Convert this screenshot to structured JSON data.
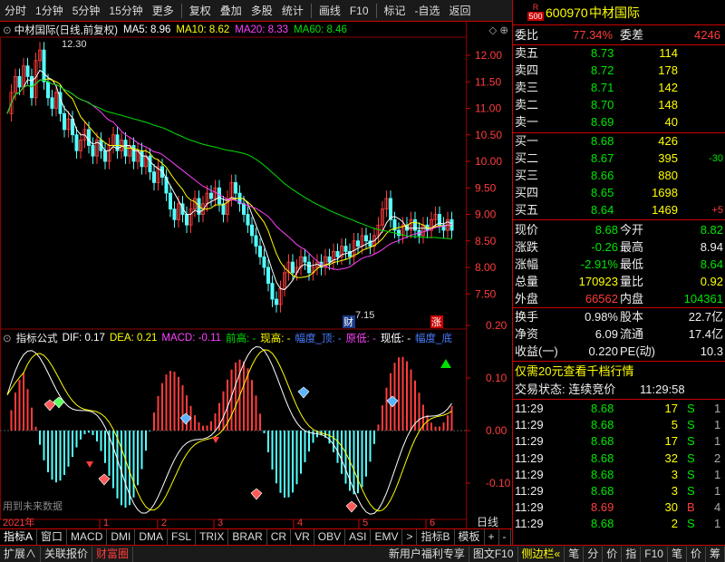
{
  "toolbar": {
    "buttons": [
      "分时",
      "1分钟",
      "5分钟",
      "15分钟",
      "更多",
      "复权",
      "叠加",
      "多股",
      "统计",
      "画线",
      "F10",
      "标记",
      "-自选",
      "返回"
    ]
  },
  "chart": {
    "title": "中材国际(日线,前复权)",
    "ma": [
      {
        "label": "MA5: 8.96",
        "color": "#ffffff"
      },
      {
        "label": "MA10: 8.62",
        "color": "#ffff00"
      },
      {
        "label": "MA20: 8.33",
        "color": "#ff40ff"
      },
      {
        "label": "MA60: 8.46",
        "color": "#00e000"
      }
    ],
    "price_ticks": [
      "12.00",
      "11.50",
      "11.00",
      "10.50",
      "10.00",
      "9.50",
      "9.00",
      "8.50",
      "8.00",
      "7.50"
    ],
    "high_label": "12.30",
    "low_label": "7.15",
    "marker_cai": "财",
    "marker_zhang": "涨"
  },
  "indicator": {
    "title": "指标公式",
    "items": [
      {
        "label": "DIF: 0.17",
        "color": "#ffffff"
      },
      {
        "label": "DEA: 0.21",
        "color": "#ffff00"
      },
      {
        "label": "MACD: -0.11",
        "color": "#ff40ff"
      },
      {
        "label": "前高: -",
        "color": "#00e000"
      },
      {
        "label": "现高: -",
        "color": "#ffff00"
      },
      {
        "label": "幅度_顶: -",
        "color": "#4a7dff"
      },
      {
        "label": "原低: -",
        "color": "#ff40ff"
      },
      {
        "label": "现低: -",
        "color": "#ffffff"
      },
      {
        "label": "幅度_底",
        "color": "#4a7dff"
      }
    ],
    "ticks": [
      "0.20",
      "0.10",
      "0.00",
      "-0.10"
    ],
    "future_note": "用到未来数据"
  },
  "date_axis": {
    "year": "2021年",
    "months": [
      "1",
      "2",
      "3",
      "4",
      "5",
      "6"
    ],
    "unit": "日线"
  },
  "bottom_tabs": [
    "指标A",
    "窗口",
    "MACD",
    "DMI",
    "DMA",
    "FSL",
    "TRIX",
    "BRAR",
    "CR",
    "VR",
    "OBV",
    "ASI",
    "EMV",
    ">",
    "指标B",
    "模板",
    "+",
    "-"
  ],
  "status_bar": [
    "扩展∧",
    "关联报价",
    "财富圈",
    "新用户福利专享",
    "图文F10",
    "侧边栏«",
    "笔",
    "分",
    "价",
    "指",
    "F10",
    "笔",
    "价",
    "筹"
  ],
  "quote": {
    "code": "600970",
    "name": "中材国际",
    "badge_top": "R",
    "badge_bottom": "500",
    "weibi_label": "委比",
    "weibi": "77.34%",
    "weicha_label": "委差",
    "weicha": "4246",
    "asks": [
      {
        "label": "卖五",
        "price": "8.73",
        "vol": "114"
      },
      {
        "label": "卖四",
        "price": "8.72",
        "vol": "178"
      },
      {
        "label": "卖三",
        "price": "8.71",
        "vol": "142"
      },
      {
        "label": "卖二",
        "price": "8.70",
        "vol": "148"
      },
      {
        "label": "卖一",
        "price": "8.69",
        "vol": "40"
      }
    ],
    "bids": [
      {
        "label": "买一",
        "price": "8.68",
        "vol": "426",
        "chg": ""
      },
      {
        "label": "买二",
        "price": "8.67",
        "vol": "395",
        "chg": "-30"
      },
      {
        "label": "买三",
        "price": "8.66",
        "vol": "880",
        "chg": ""
      },
      {
        "label": "买四",
        "price": "8.65",
        "vol": "1698",
        "chg": ""
      },
      {
        "label": "买五",
        "price": "8.64",
        "vol": "1469",
        "chg": "+5"
      }
    ],
    "stats": [
      {
        "l1": "现价",
        "v1": "8.68",
        "c1": "green",
        "l2": "今开",
        "v2": "8.82",
        "c2": "green"
      },
      {
        "l1": "涨跌",
        "v1": "-0.26",
        "c1": "green",
        "l2": "最高",
        "v2": "8.94",
        "c2": "white"
      },
      {
        "l1": "涨幅",
        "v1": "-2.91%",
        "c1": "green",
        "l2": "最低",
        "v2": "8.64",
        "c2": "green"
      },
      {
        "l1": "总量",
        "v1": "170923",
        "c1": "yellow",
        "l2": "量比",
        "v2": "0.92",
        "c2": "yellow"
      },
      {
        "l1": "外盘",
        "v1": "66562",
        "c1": "red",
        "l2": "内盘",
        "v2": "104361",
        "c2": "green"
      }
    ],
    "stats2": [
      {
        "l1": "换手",
        "v1": "0.98%",
        "l2": "股本",
        "v2": "22.7亿"
      },
      {
        "l1": "净资",
        "v1": "6.09",
        "l2": "流通",
        "v2": "17.4亿"
      },
      {
        "l1": "收益(一)",
        "v1": "0.220",
        "l2": "PE(动)",
        "v2": "10.3"
      }
    ],
    "promo": "仅需20元查看千档行情",
    "trade_state": "交易状态: 连续竞价",
    "trade_time": "11:29:58",
    "ticks": [
      {
        "t": "11:29",
        "p": "8.68",
        "v": "17",
        "s": "S",
        "n": "1"
      },
      {
        "t": "11:29",
        "p": "8.68",
        "v": "5",
        "s": "S",
        "n": "1"
      },
      {
        "t": "11:29",
        "p": "8.68",
        "v": "17",
        "s": "S",
        "n": "1"
      },
      {
        "t": "11:29",
        "p": "8.68",
        "v": "32",
        "s": "S",
        "n": "2"
      },
      {
        "t": "11:29",
        "p": "8.68",
        "v": "3",
        "s": "S",
        "n": "1"
      },
      {
        "t": "11:29",
        "p": "8.68",
        "v": "3",
        "s": "S",
        "n": "1"
      },
      {
        "t": "11:29",
        "p": "8.69",
        "v": "30",
        "s": "B",
        "n": "4"
      },
      {
        "t": "11:29",
        "p": "8.68",
        "v": "2",
        "s": "S",
        "n": "1"
      }
    ]
  }
}
